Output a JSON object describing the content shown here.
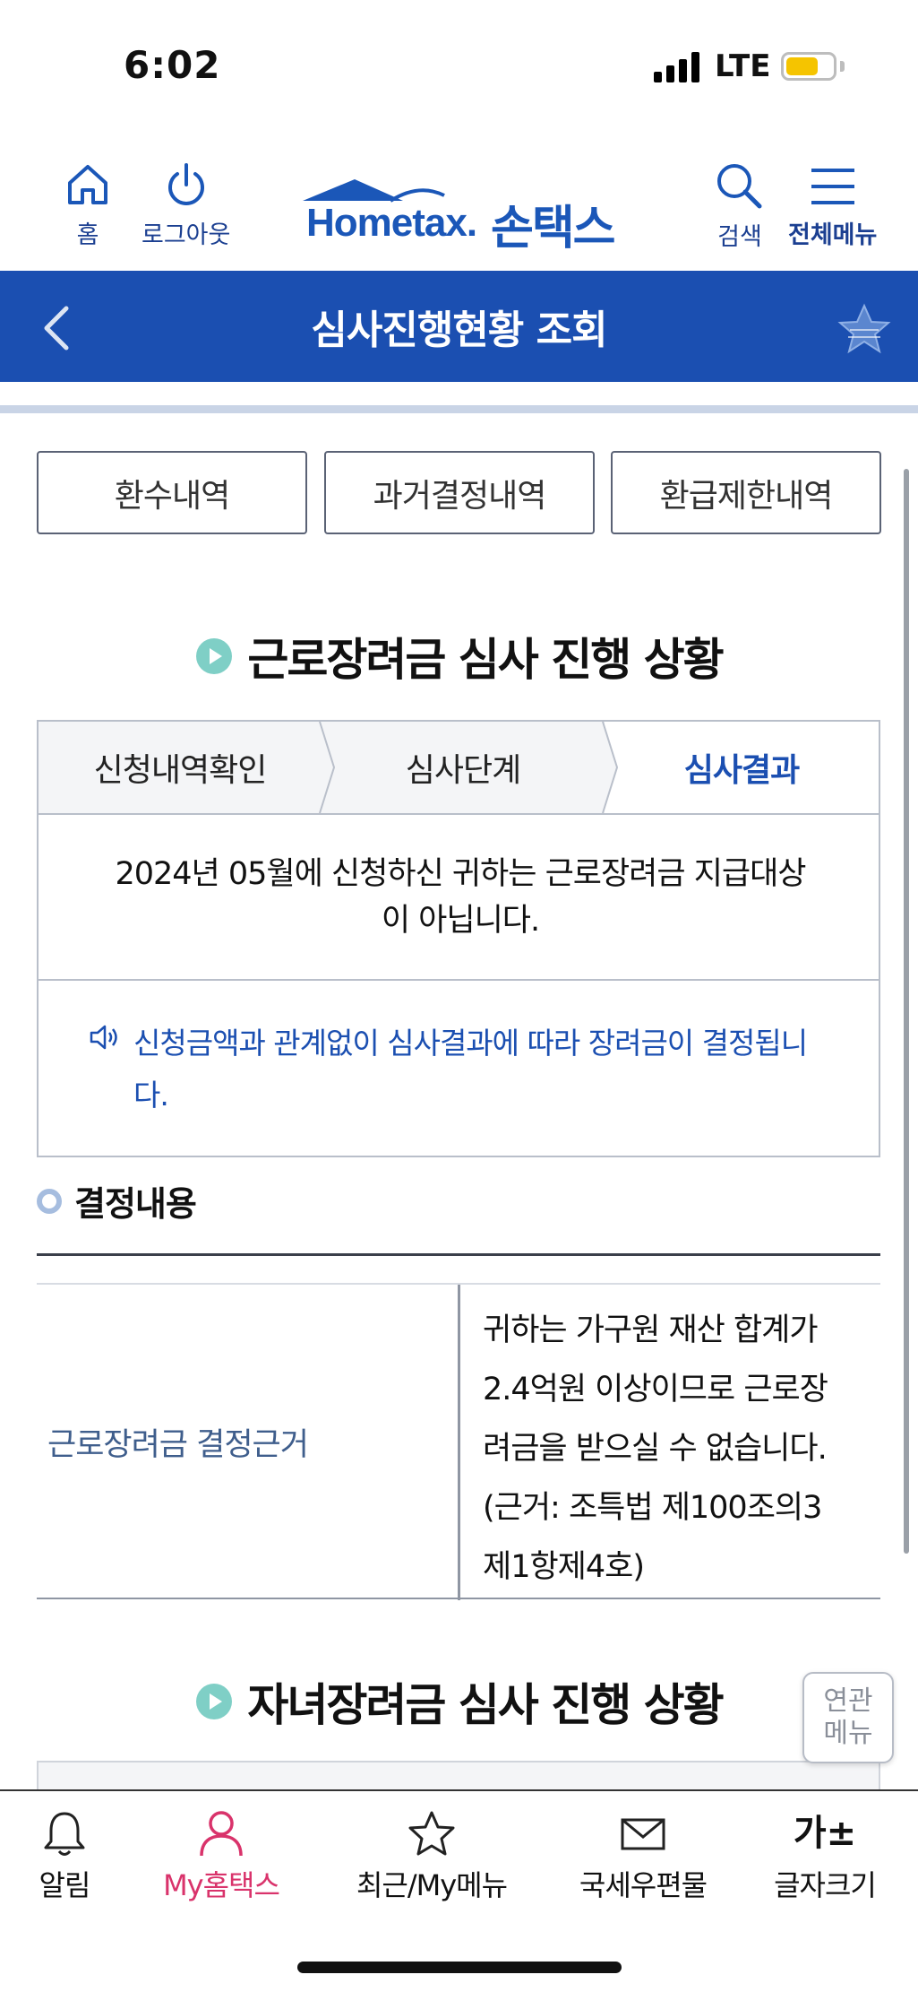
{
  "status_bar": {
    "time": "6:02",
    "network": "LTE",
    "battery_level": 0.7
  },
  "top_nav": {
    "home_label": "홈",
    "logout_label": "로그아웃",
    "logo_text": "Hometax.",
    "logo_korean": "손택스",
    "search_label": "검색",
    "menu_label": "전체메뉴"
  },
  "title_bar": {
    "title": "심사진행현황 조회"
  },
  "tab_buttons": [
    "환수내역",
    "과거결정내역",
    "환급제한내역"
  ],
  "earned_income": {
    "title": "근로장려금 심사 진행 상황",
    "steps": [
      "신청내역확인",
      "심사단계",
      "심사결과"
    ],
    "active_step": "심사결과",
    "result_line1": "2024년 05월에 신청하신 귀하는 근로장려금 지급대상",
    "result_line2": "이 아닙니다.",
    "notice_line1": "신청금액과 관계없이 심사결과에 따라 장려금이 결정됩니",
    "notice_line2": "다."
  },
  "decision": {
    "heading": "결정내용",
    "label": "근로장려금 결정근거",
    "value_lines": [
      "귀하는 가구원 재산 합계가",
      "2.4억원 이상이므로 근로장",
      "려금을 받으실 수 없습니다.",
      "(근거: 조특법 제100조의3",
      "제1항제4호)"
    ]
  },
  "child_support": {
    "title": "자녀장려금 심사 진행 상황"
  },
  "related_menu": {
    "line1": "연관",
    "line2": "메뉴"
  },
  "bottom_nav": {
    "items": [
      "알림",
      "My홈택스",
      "최근/My메뉴",
      "국세우편물",
      "글자크기"
    ],
    "active": "My홈택스",
    "font_size_glyph": "가±"
  },
  "colors": {
    "primary_blue": "#1b4fb1",
    "accent_teal": "#7fcfc6",
    "active_pink": "#d9336b"
  }
}
